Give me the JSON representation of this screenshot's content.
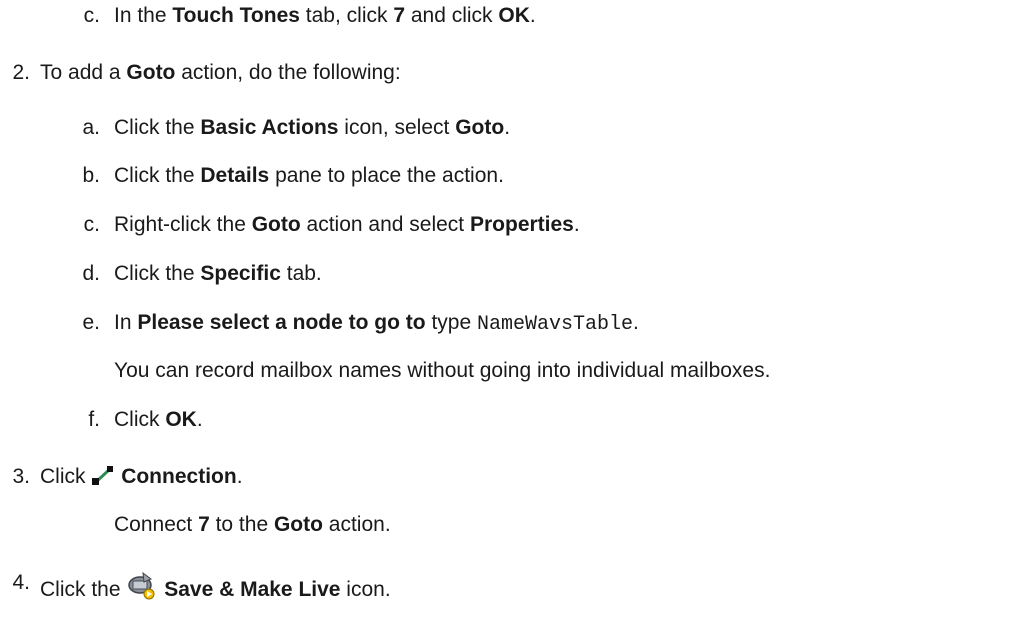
{
  "step1c": {
    "marker": "c.",
    "t1": "In the ",
    "b1": "Touch Tones",
    "t2": " tab, click ",
    "b2": "7",
    "t3": " and click ",
    "b3": "OK",
    "t4": "."
  },
  "step2": {
    "marker": "2.",
    "t1": "To add a ",
    "b1": "Goto",
    "t2": " action, do the following:"
  },
  "step2a": {
    "marker": "a.",
    "t1": "Click the ",
    "b1": "Basic Actions",
    "t2": " icon, select ",
    "b2": "Goto",
    "t3": "."
  },
  "step2b": {
    "marker": "b.",
    "t1": "Click the ",
    "b1": "Details",
    "t2": " pane to place the action."
  },
  "step2c": {
    "marker": "c.",
    "t1": "Right-click the ",
    "b1": "Goto",
    "t2": " action and select ",
    "b2": "Properties",
    "t3": "."
  },
  "step2d": {
    "marker": "d.",
    "t1": "Click the ",
    "b1": "Specific",
    "t2": " tab."
  },
  "step2e": {
    "marker": "e.",
    "t1": "In ",
    "b1": "Please select a node to go to",
    "t2": " type ",
    "code": "NameWavsTable",
    "t3": "."
  },
  "step2e_note": "You can record mailbox names without going into individual mailboxes.",
  "step2f": {
    "marker": "f.",
    "t1": "Click ",
    "b1": "OK",
    "t2": "."
  },
  "step3": {
    "marker": "3.",
    "t1": "Click ",
    "icon": "connection-line-icon",
    "b1": "Connection",
    "t2": "."
  },
  "step3_note": {
    "t1": "Connect ",
    "b1": "7",
    "t2": " to the ",
    "b2": "Goto",
    "t3": " action."
  },
  "step4": {
    "marker": "4.",
    "t1": "Click the ",
    "icon": "save-make-live-icon",
    "b1": "Save & Make Live",
    "t2": " icon."
  }
}
